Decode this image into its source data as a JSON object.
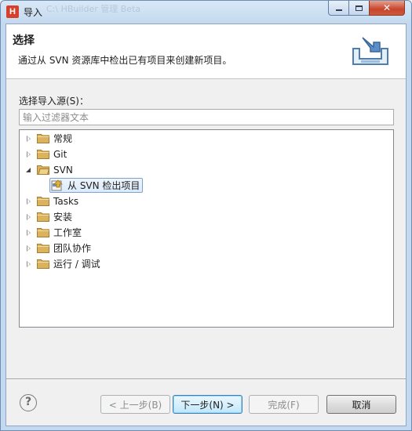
{
  "window": {
    "title": "导入",
    "app_icon_letter": "H",
    "ghost_title": "C:\\ HBuilder 管理 Beta"
  },
  "header": {
    "title": "选择",
    "description": "通过从 SVN 资源库中检出已有项目来创建新项目。"
  },
  "source": {
    "label": "选择导入源(S)：",
    "filter_placeholder": "输入过滤器文本",
    "filter_value": ""
  },
  "tree": {
    "items": [
      {
        "label": "常规",
        "expanded": false
      },
      {
        "label": "Git",
        "expanded": false
      },
      {
        "label": "SVN",
        "expanded": true
      },
      {
        "label": "从 SVN 检出项目",
        "child": true,
        "selected": true
      },
      {
        "label": "Tasks",
        "expanded": false
      },
      {
        "label": "安装",
        "expanded": false
      },
      {
        "label": "工作室",
        "expanded": false
      },
      {
        "label": "团队协作",
        "expanded": false
      },
      {
        "label": "运行 / 调试",
        "expanded": false
      }
    ]
  },
  "buttons": {
    "back": "< 上一步(B)",
    "next": "下一步(N) >",
    "finish": "完成(F)",
    "cancel": "取消"
  },
  "help_symbol": "?",
  "window_buttons": {
    "close": "✕"
  },
  "colors": {
    "title_bar": "#c4d9ef",
    "close_button": "#c7452d",
    "folder": "#dcb35c",
    "selection_border": "#7da2ce",
    "default_button": "#3c7fb1"
  }
}
